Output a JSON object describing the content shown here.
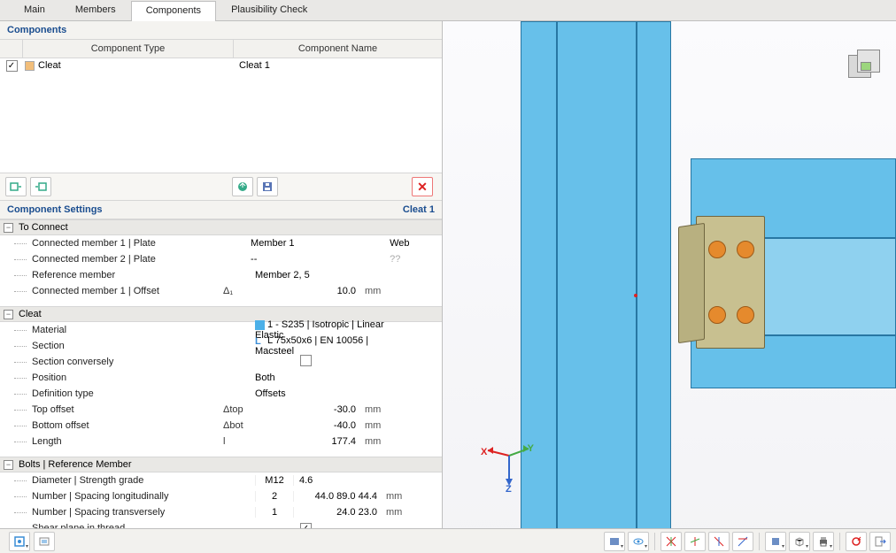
{
  "tabs": [
    "Main",
    "Members",
    "Components",
    "Plausibility Check"
  ],
  "active_tab": 2,
  "components_panel": {
    "title": "Components",
    "cols": [
      "Component Type",
      "Component Name"
    ],
    "rows": [
      {
        "checked": true,
        "type": "Cleat",
        "name": "Cleat 1"
      }
    ]
  },
  "settings_panel": {
    "title": "Component Settings",
    "subval": "Cleat 1",
    "groups": [
      {
        "title": "To Connect",
        "rows": [
          {
            "label": "Connected member 1 | Plate",
            "val_left": "Member 1",
            "val_right": "Web"
          },
          {
            "label": "Connected member 2 | Plate",
            "val_left": "--",
            "val_right": "??",
            "right_grey": true
          },
          {
            "label": "Reference member",
            "val_left": "Member 2, 5"
          },
          {
            "label": "Connected member 1 | Offset",
            "sym": "Δ₁",
            "num": "10.0",
            "unit": "mm"
          }
        ]
      },
      {
        "title": "Cleat",
        "rows": [
          {
            "label": "Material",
            "mat": true,
            "val_left": "1 - S235 | Isotropic | Linear Elastic"
          },
          {
            "label": "Section",
            "sec": true,
            "val_left": "L 75x50x6 | EN 10056 | Macsteel"
          },
          {
            "label": "Section conversely",
            "checkbox": true,
            "checked": false
          },
          {
            "label": "Position",
            "val_left": "Both"
          },
          {
            "label": "Definition type",
            "val_left": "Offsets"
          },
          {
            "label": "Top offset",
            "sym": "Δtop",
            "num": "-30.0",
            "unit": "mm"
          },
          {
            "label": "Bottom offset",
            "sym": "Δbot",
            "num": "-40.0",
            "unit": "mm"
          },
          {
            "label": "Length",
            "sym": "l",
            "num": "177.4",
            "unit": "mm"
          }
        ]
      },
      {
        "title": "Bolts | Reference Member",
        "rows": [
          {
            "label": "Diameter | Strength grade",
            "mid": "M12",
            "val_left2": "4.6"
          },
          {
            "label": "Number | Spacing longitudinally",
            "mid": "2",
            "num": "44.0 89.0 44.4",
            "unit": "mm"
          },
          {
            "label": "Number | Spacing transversely",
            "mid": "1",
            "num": "24.0 23.0",
            "unit": "mm"
          },
          {
            "label": "Shear plane in thread",
            "checkbox": true,
            "checked": true
          }
        ]
      }
    ]
  }
}
